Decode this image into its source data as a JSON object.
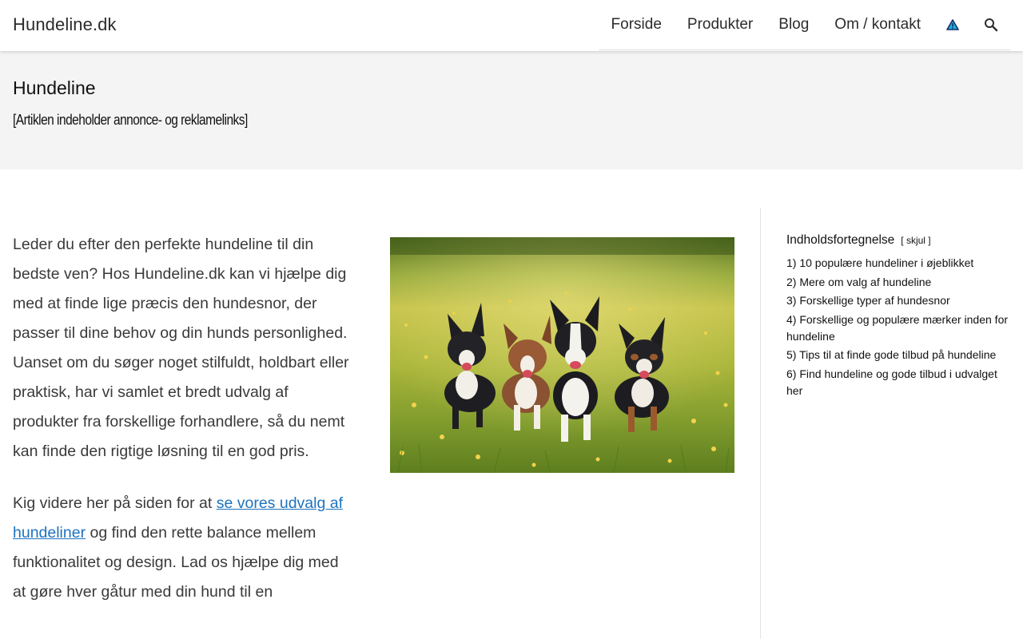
{
  "header": {
    "site_title": "Hundeline.dk",
    "nav": [
      "Forside",
      "Produkter",
      "Blog",
      "Om / kontakt"
    ],
    "icons": [
      "warning-triangle-icon",
      "search-icon"
    ]
  },
  "page": {
    "title": "Hundeline",
    "disclaimer": "[Artiklen indeholder annonce- og reklamelinks]"
  },
  "content": {
    "intro": "Leder du efter den perfekte hundeline til din bedste ven? Hos Hundeline.dk kan vi hjælpe dig med at finde lige præcis den hundesnor, der passer til dine behov og din hunds personlighed. Uanset om du søger noget stilfuldt, holdbart eller praktisk, har vi samlet et bredt udvalg af produkter fra forskellige forhandlere, så du nemt kan finde den rigtige løsning til en god pris.",
    "p2_before": "Kig videre her på siden for at ",
    "p2_link": "se vores udvalg af hundeliner",
    "p2_after": " og find den rette balance mellem funktionalitet og design. Lad os hjælpe dig med at gøre hver gåtur med din hund til en"
  },
  "toc": {
    "title": "Indholdsfortegnelse",
    "toggle": "[ skjul ]",
    "items": [
      "1) 10 populære hundeliner i øjeblikket",
      "2) Mere om valg af hundeline",
      "3) Forskellige typer af hundesnor",
      "4) Forskellige og populære mærker inden for hundeline",
      "5) Tips til at finde gode tilbud på hundeline",
      "6) Find hundeline og gode tilbud i udvalget her"
    ]
  },
  "colors": {
    "link": "#1e73be",
    "title_band": "#f4f4f4",
    "warning_icon_fill": "#19b5d6"
  }
}
